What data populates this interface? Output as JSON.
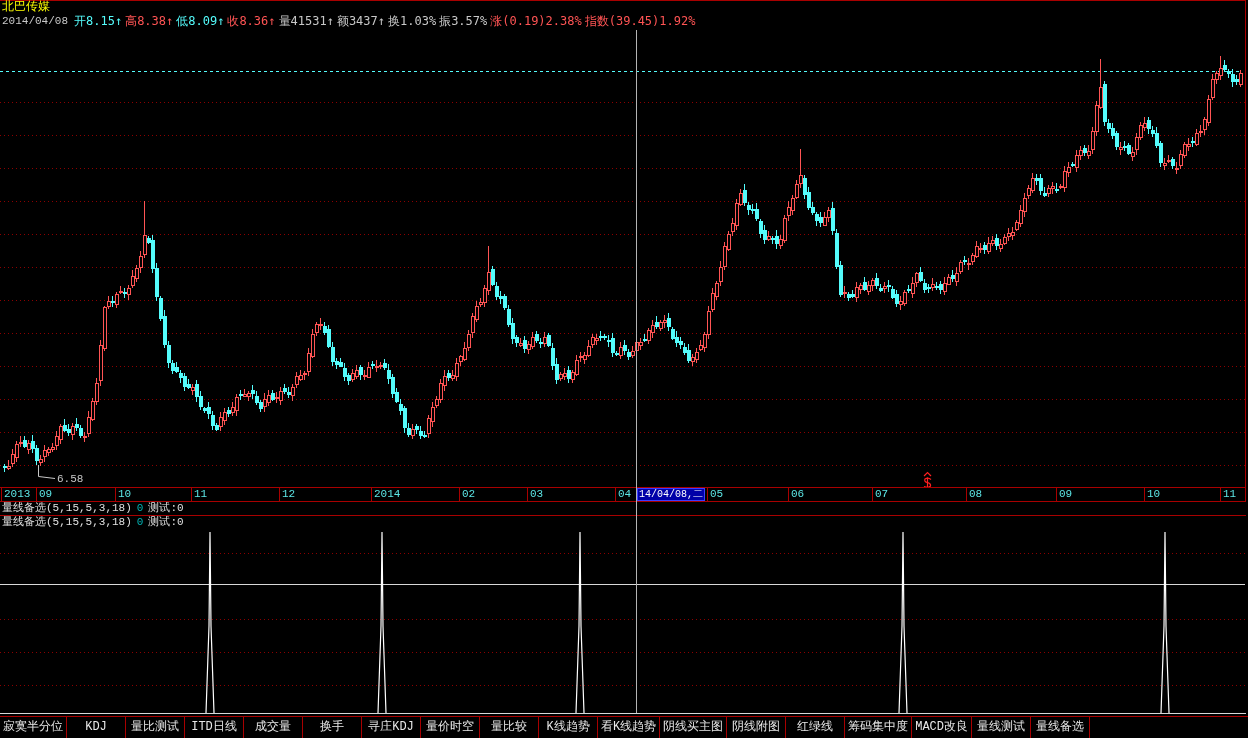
{
  "security": {
    "name": "北巴传媒",
    "date": "2014/04/08",
    "quotes": [
      {
        "label": "开",
        "value": "8.15",
        "arrow": "↑",
        "color": "#54fcfc"
      },
      {
        "label": "高",
        "value": "8.38",
        "arrow": "↑",
        "color": "#ff5454"
      },
      {
        "label": "低",
        "value": "8.09",
        "arrow": "↑",
        "color": "#54fcfc"
      },
      {
        "label": "收",
        "value": "8.36",
        "arrow": "↑",
        "color": "#ff5454"
      },
      {
        "label": "量",
        "value": "41531",
        "arrow": "↑",
        "color": "#c8c8c8"
      },
      {
        "label": "额",
        "value": "3437",
        "arrow": "↑",
        "color": "#c8c8c8"
      },
      {
        "label": "换",
        "value": "1.03%",
        "color": "#c8c8c8"
      },
      {
        "label": "振",
        "value": "3.57%",
        "color": "#c8c8c8"
      },
      {
        "label": "涨",
        "value": "(0.19)2.38%",
        "color": "#ff5454"
      },
      {
        "label": "指数",
        "value": "(39.45)1.92%",
        "color": "#ff5454"
      }
    ]
  },
  "price_chart": {
    "low_label": "6.58"
  },
  "date_axis": {
    "labels": [
      "2013",
      "09",
      "10",
      "11",
      "12",
      "2014",
      "02",
      "03",
      "04",
      "05",
      "06",
      "07",
      "08",
      "09",
      "10",
      "11"
    ],
    "cursor_label": "14/04/08,二"
  },
  "indicator": {
    "lines": [
      {
        "name": "量线备选(5,15,5,3,18)",
        "value": "0",
        "output": "测试:0"
      },
      {
        "name": "量线备选(5,15,5,3,18)",
        "value": "0",
        "output": "测试:0"
      }
    ]
  },
  "tabs": [
    "寂寞半分位",
    "KDJ",
    "量比测试",
    "ITD日线",
    "成交量",
    "换手",
    "寻庄KDJ",
    "量价时空",
    "量比较",
    "K线趋势",
    "看K线趋势",
    "阴线买主图",
    "阴线附图",
    "红绿线",
    "筹码集中度",
    "MACD改良",
    "量线测试",
    "量线备选"
  ]
}
